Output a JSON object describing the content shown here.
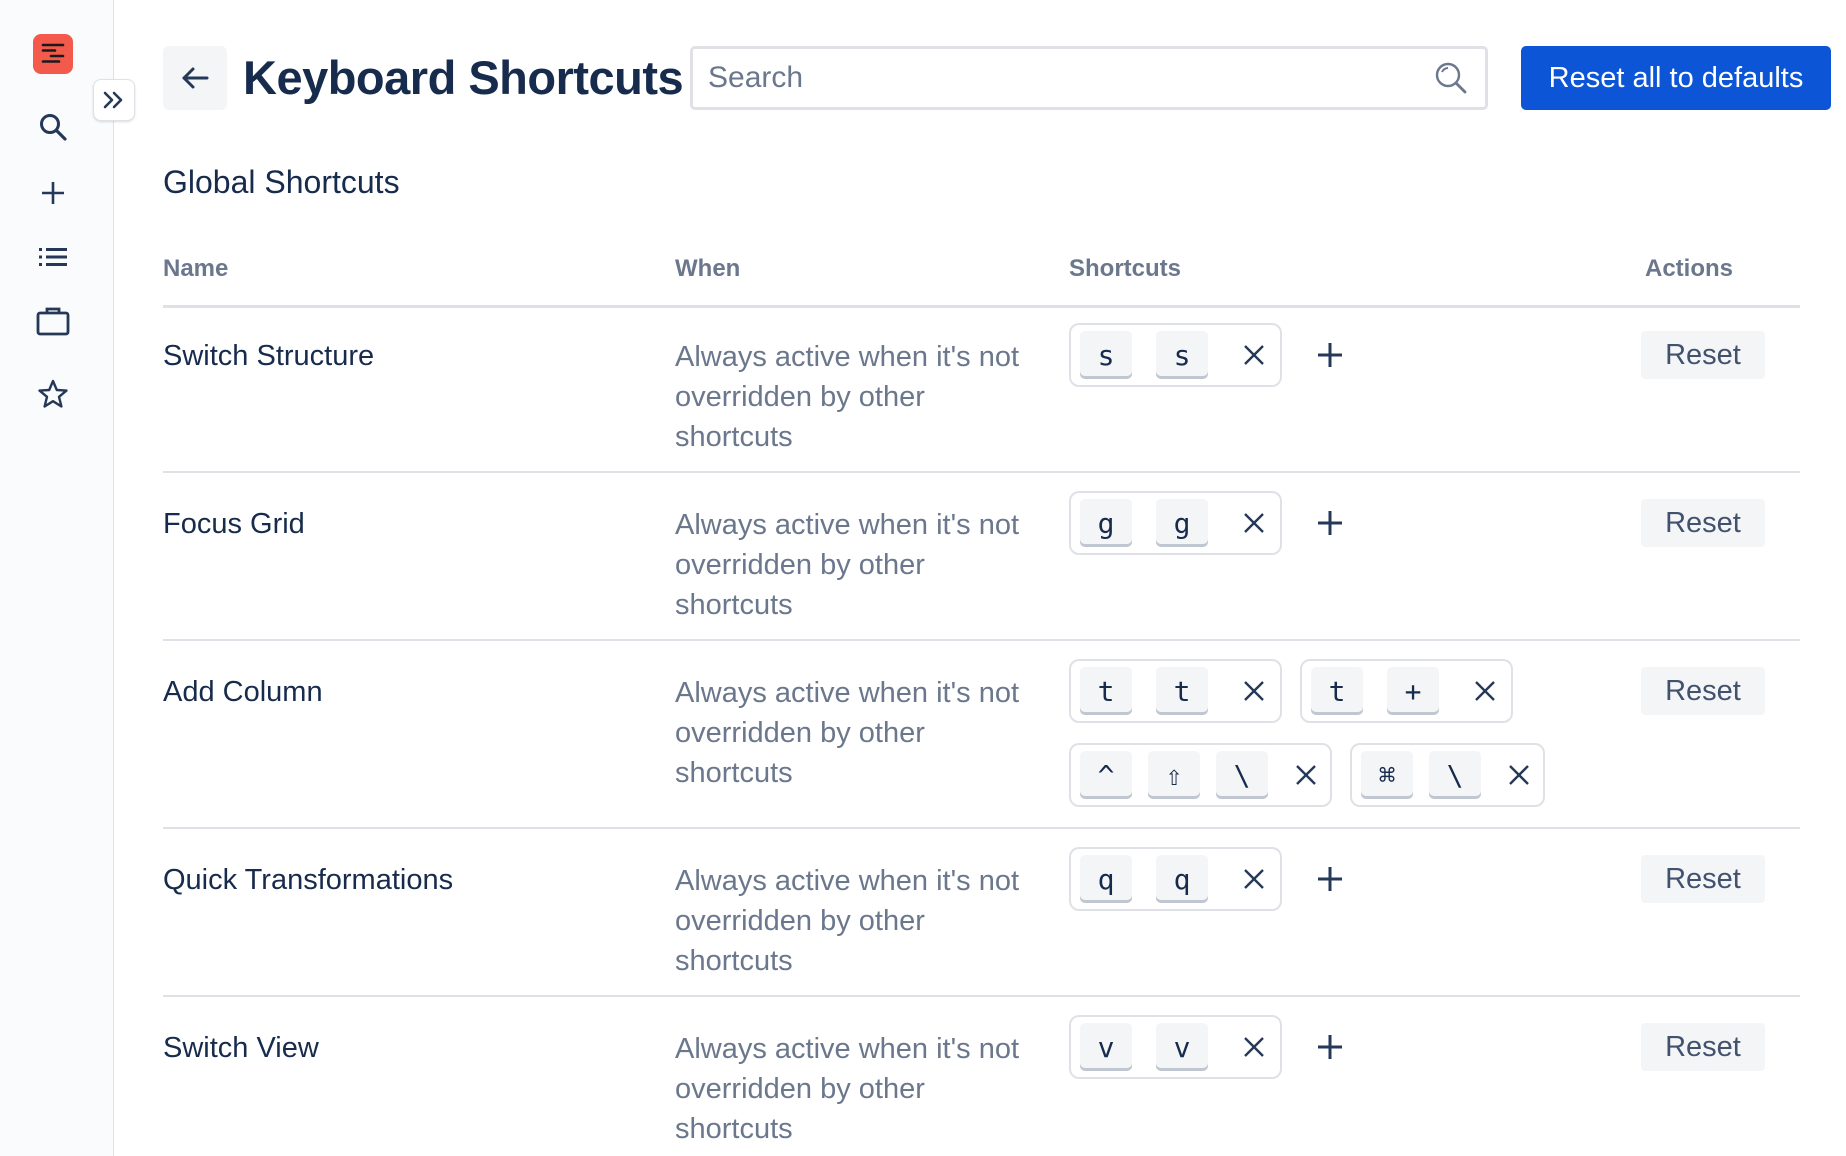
{
  "sidebar": {
    "items": [
      {
        "icon": "app-logo-icon"
      },
      {
        "icon": "search-icon"
      },
      {
        "icon": "plus-icon"
      },
      {
        "icon": "list-icon"
      },
      {
        "icon": "briefcase-icon"
      },
      {
        "icon": "star-icon"
      }
    ],
    "collapse_icon": "double-chevron-right-icon",
    "logo_color": "#f35a4b"
  },
  "header": {
    "back_icon": "arrow-left-icon",
    "title": "Keyboard Shortcuts",
    "search_placeholder": "Search",
    "search_value": "",
    "reset_all_label": "Reset all to defaults",
    "accent_color": "#0c55d6"
  },
  "section": {
    "title": "Global Shortcuts"
  },
  "table": {
    "columns": {
      "name": "Name",
      "when": "When",
      "shortcuts": "Shortcuts",
      "actions": "Actions"
    },
    "rows": [
      {
        "name": "Switch Structure",
        "when": "Always active when it's not overridden by other shortcuts",
        "combos": [
          [
            "s",
            "s"
          ]
        ],
        "reset_label": "Reset"
      },
      {
        "name": "Focus Grid",
        "when": "Always active when it's not overridden by other shortcuts",
        "combos": [
          [
            "g",
            "g"
          ]
        ],
        "reset_label": "Reset"
      },
      {
        "name": "Add Column",
        "when": "Always active when it's not overridden by other shortcuts",
        "combos": [
          [
            "t",
            "t"
          ],
          [
            "t",
            "+"
          ],
          [
            "^",
            "⇧",
            "\\"
          ],
          [
            "⌘",
            "\\"
          ]
        ],
        "reset_label": "Reset"
      },
      {
        "name": "Quick Transformations",
        "when": "Always active when it's not overridden by other shortcuts",
        "combos": [
          [
            "q",
            "q"
          ]
        ],
        "reset_label": "Reset"
      },
      {
        "name": "Switch View",
        "when": "Always active when it's not overridden by other shortcuts",
        "combos": [
          [
            "v",
            "v"
          ]
        ],
        "reset_label": "Reset"
      }
    ]
  }
}
